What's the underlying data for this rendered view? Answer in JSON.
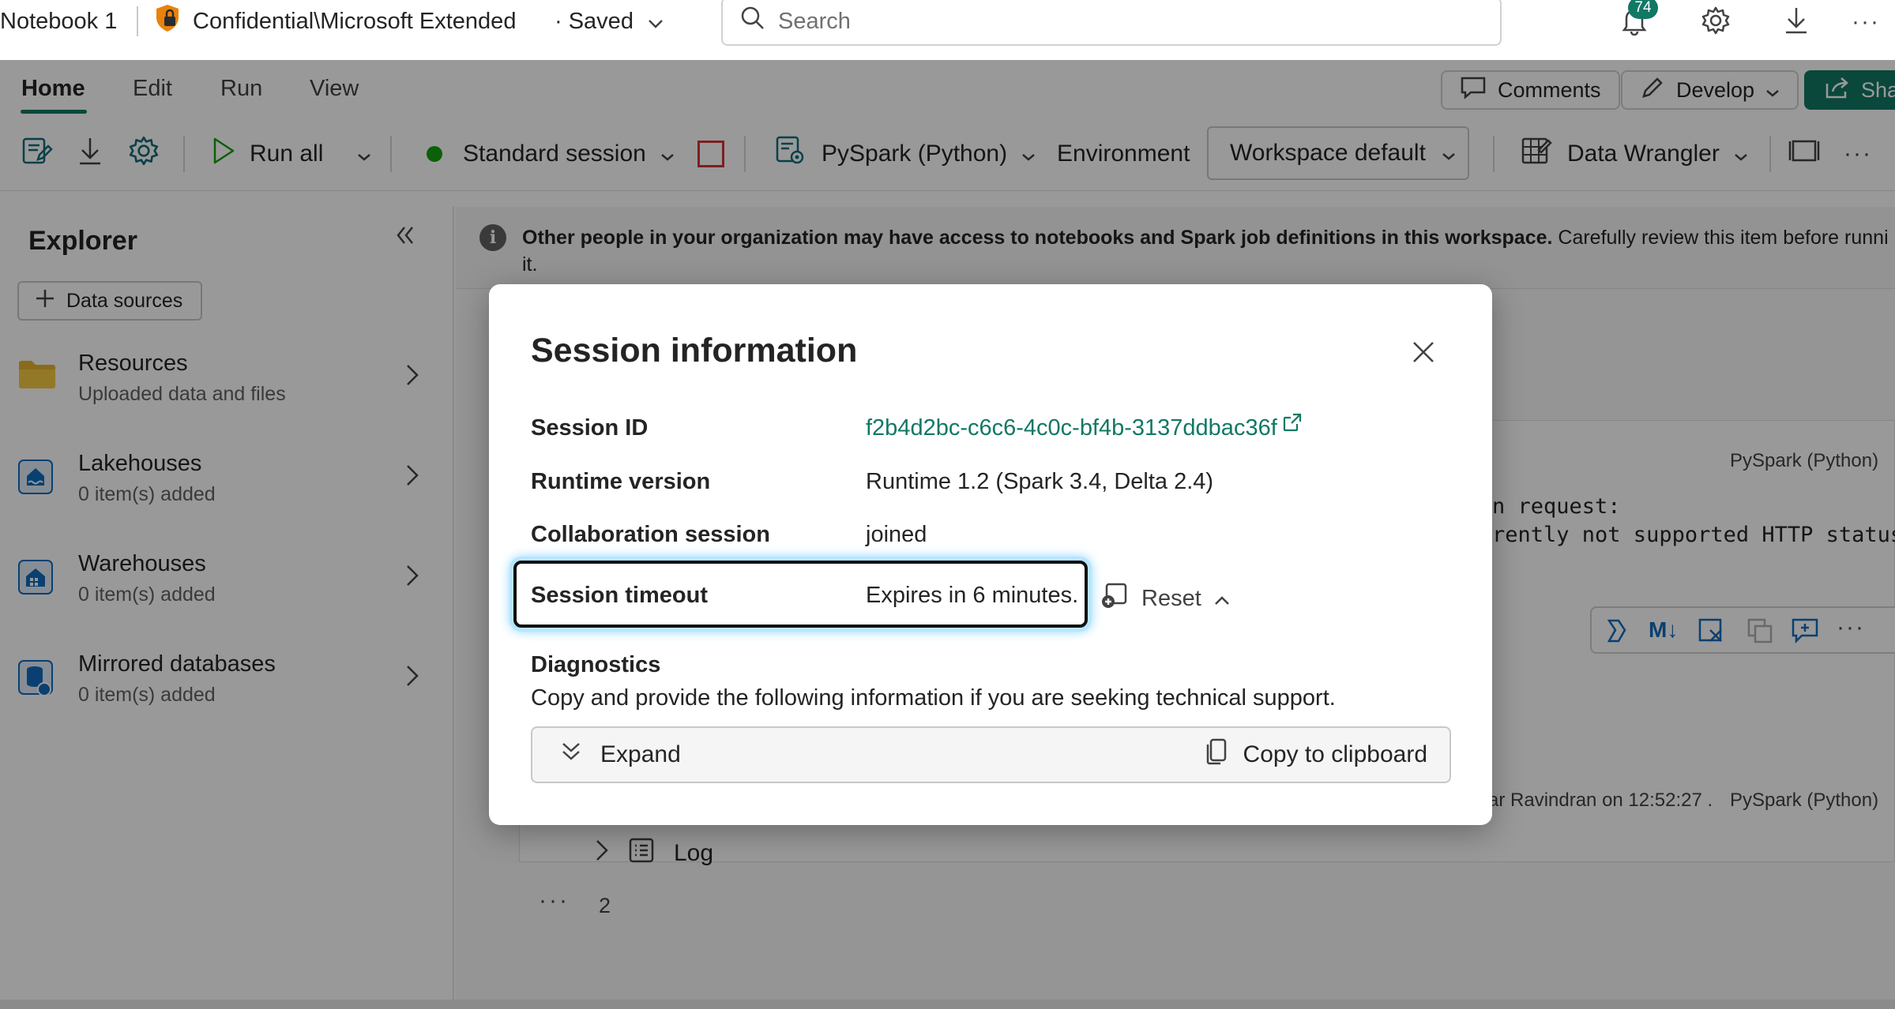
{
  "titlebar": {
    "notebook_name": "Notebook 1",
    "sensitivity_label": "Confidential\\Microsoft Extended",
    "save_status": "· Saved",
    "search_placeholder": "Search",
    "notification_count": "74"
  },
  "ribbon": {
    "tabs": [
      "Home",
      "Edit",
      "Run",
      "View"
    ],
    "active_tab": "Home",
    "comments_label": "Comments",
    "develop_label": "Develop",
    "share_label": "Shar"
  },
  "toolbar": {
    "run_all_label": "Run all",
    "session_label": "Standard session",
    "language_label": "PySpark (Python)",
    "environment_label": "Environment",
    "workspace_label": "Workspace default",
    "data_wrangler_label": "Data Wrangler"
  },
  "explorer": {
    "title": "Explorer",
    "data_sources_label": "Data sources",
    "items": [
      {
        "name": "Resources",
        "sub": "Uploaded data and files",
        "icon": "folder-icon"
      },
      {
        "name": "Lakehouses",
        "sub": "0 item(s) added",
        "icon": "lakehouse-icon"
      },
      {
        "name": "Warehouses",
        "sub": "0 item(s) added",
        "icon": "warehouse-icon"
      },
      {
        "name": "Mirrored databases",
        "sub": "0 item(s) added",
        "icon": "mirrored-db-icon"
      }
    ]
  },
  "notebook": {
    "info_bold": "Other people in your organization may have access to notebooks and Spark job definitions in this workspace.",
    "info_rest": " Carefully review this item before runni",
    "info_wrap": "it.",
    "cell1_lang": "PySpark (Python)",
    "code_line1": "n request:",
    "code_line2": "rently not supported HTTP status",
    "cell2_meta": "ar Ravindran on 12:52:27 .",
    "cell2_lang": "PySpark (Python)",
    "log_label": "Log",
    "cell_number": "2"
  },
  "dialog": {
    "title": "Session information",
    "rows": [
      {
        "label": "Session ID",
        "value": "f2b4d2bc-c6c6-4c0c-bf4b-3137ddbac36f"
      },
      {
        "label": "Runtime version",
        "value": "Runtime 1.2 (Spark 3.4, Delta 2.4)"
      },
      {
        "label": "Collaboration session",
        "value": "joined"
      },
      {
        "label": "Session timeout",
        "value": "Expires in 6 minutes."
      }
    ],
    "reset_label": "Reset",
    "diagnostics_title": "Diagnostics",
    "diagnostics_desc": "Copy and provide the following information if you are seeking technical support.",
    "expand_label": "Expand",
    "copy_label": "Copy to clipboard"
  },
  "colors": {
    "accent": "#117865",
    "focus_glow": "#7fd0ff",
    "scroll_blue": "#0f6cbd"
  }
}
